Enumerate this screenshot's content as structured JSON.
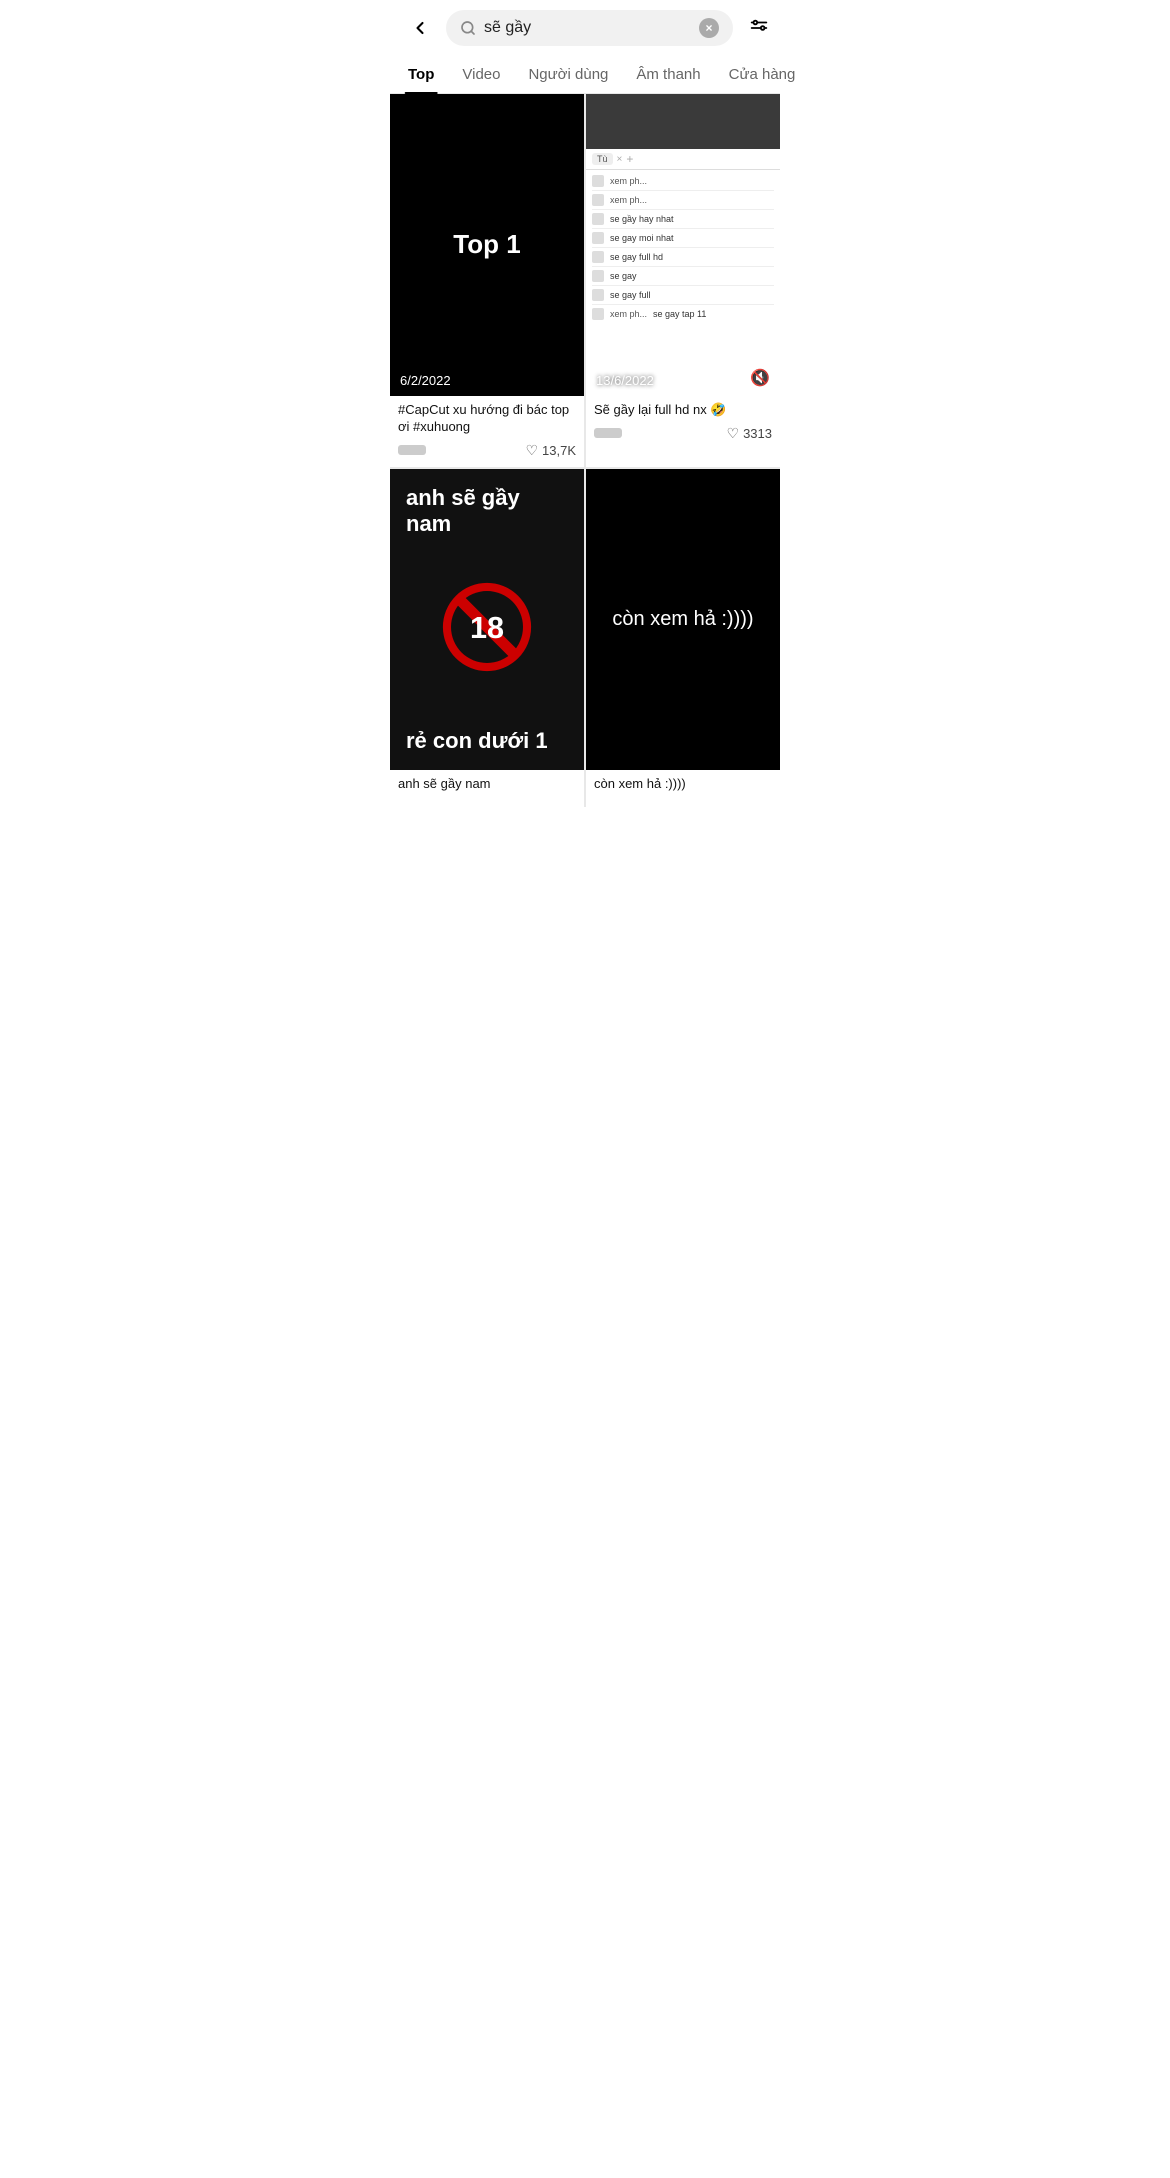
{
  "header": {
    "back_label": "back",
    "search_value": "sẽ gầy",
    "clear_label": "×",
    "filter_label": "filter"
  },
  "tabs": {
    "items": [
      {
        "id": "top",
        "label": "Top",
        "active": true
      },
      {
        "id": "video",
        "label": "Video",
        "active": false
      },
      {
        "id": "nguoi-dung",
        "label": "Người dùng",
        "active": false
      },
      {
        "id": "am-thanh",
        "label": "Âm thanh",
        "active": false
      },
      {
        "id": "cua-hang",
        "label": "Cửa hàng",
        "active": false
      }
    ]
  },
  "videos": [
    {
      "id": 1,
      "thumb_text": "Top 1",
      "date": "6/2/2022",
      "title": "#CapCut xu hướng đi bác top ơi #xuhuong",
      "likes": "13,7K",
      "has_avatar": true,
      "type": "text_on_black"
    },
    {
      "id": 2,
      "date": "13/6/2022",
      "title": "Sẽ gầy lại full hd nx 🤣",
      "likes": "3313",
      "has_avatar": true,
      "type": "browser_screenshot",
      "search_rows": [
        "se gầy hay nhat",
        "se gay moi nhat",
        "se gay full hd",
        "se gay",
        "se gay full",
        "se gay tap 11"
      ]
    },
    {
      "id": 3,
      "top_text": "anh sẽ gầy nam",
      "bottom_text": "rẻ con dưới 1",
      "title": "anh sẽ gầy nam",
      "type": "text_18_icon"
    },
    {
      "id": 4,
      "center_text": "còn xem hả :))))",
      "title": "còn xem hả :))))",
      "type": "text_on_black_center"
    }
  ],
  "icons": {
    "back": "‹",
    "search": "🔍",
    "clear": "×",
    "filter": "⊟",
    "heart": "♡",
    "mute": "🔇",
    "no_18": "🚫"
  }
}
